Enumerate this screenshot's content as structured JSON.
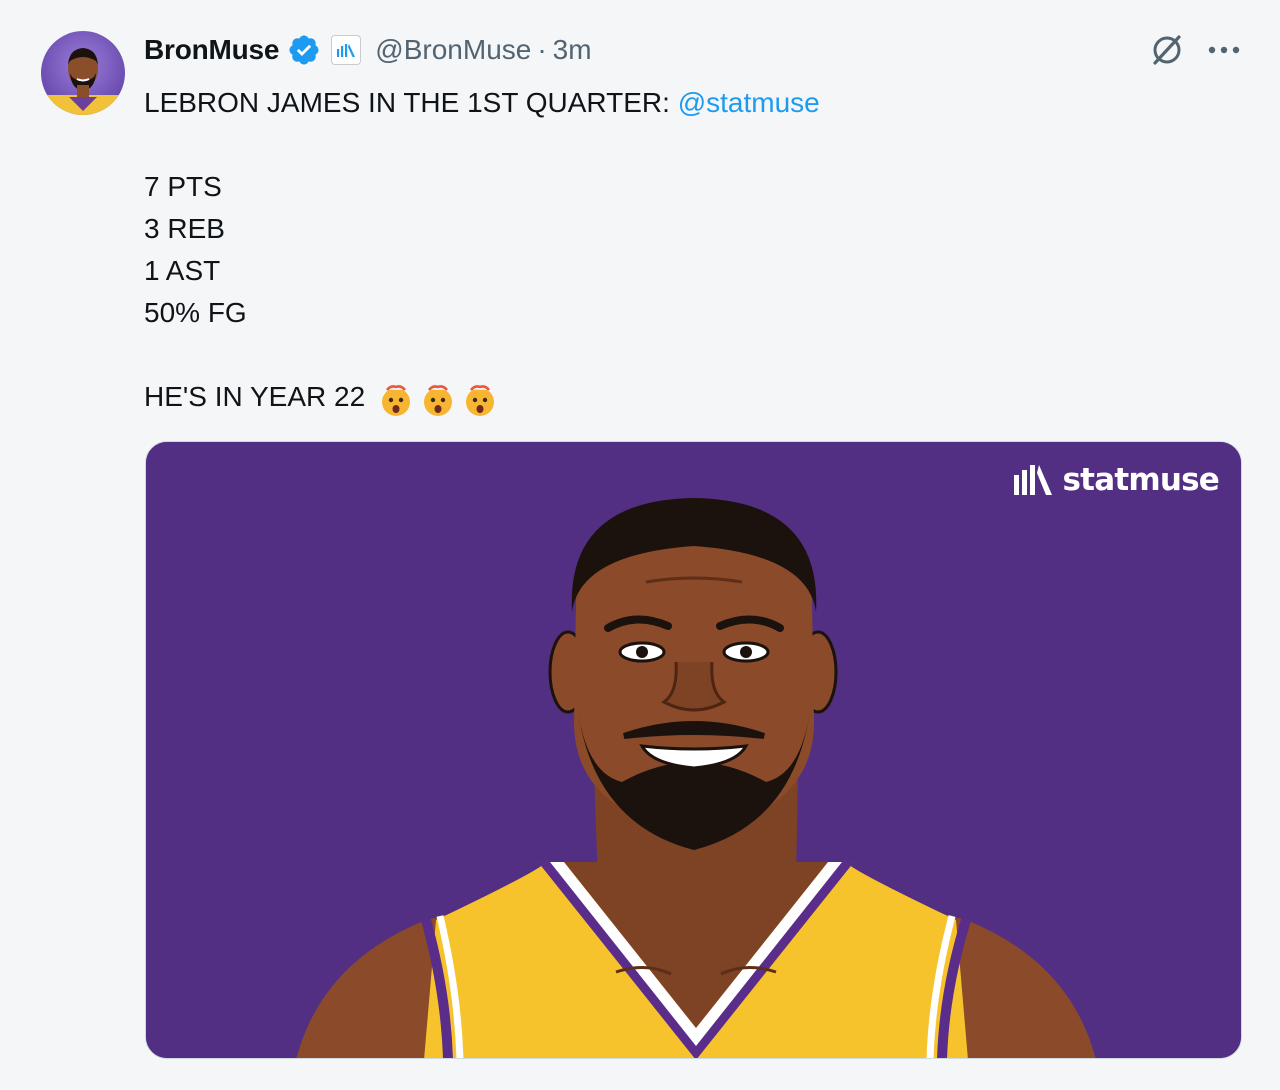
{
  "tweet": {
    "display_name": "BronMuse",
    "handle": "@BronMuse",
    "separator": "·",
    "time": "3m",
    "text_line1_prefix": "LEBRON JAMES IN THE 1ST QUARTER: ",
    "text_line1_mention": "@statmuse",
    "stats": [
      "7 PTS",
      "3 REB",
      "1 AST",
      "50% FG"
    ],
    "closing_line": "HE'S IN YEAR 22",
    "emoji": [
      "exploding-head-emoji",
      "exploding-head-emoji",
      "exploding-head-emoji"
    ]
  },
  "media": {
    "watermark": "statmuse",
    "background_color": "#522f82",
    "jersey_color": "#f7c32d"
  },
  "icons": {
    "verified": "verified-badge-icon",
    "affiliate": "statmuse-affiliate-icon",
    "grok": "grok-icon",
    "more": "more-icon"
  },
  "colors": {
    "link": "#1d9bf0",
    "verified": "#1d9bf0",
    "muted": "#536471"
  }
}
